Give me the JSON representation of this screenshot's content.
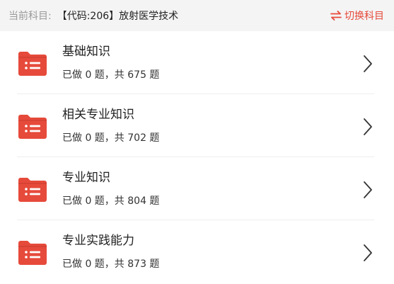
{
  "header": {
    "label": "当前科目:",
    "subject": "【代码:206】放射医学技术",
    "switch_label": "切换科目",
    "switch_icon": "swap-arrows-icon"
  },
  "colors": {
    "accent": "#e64a3b",
    "header_bg": "#f4f4f4"
  },
  "list": {
    "items": [
      {
        "title": "基础知识",
        "stats": "已做 0 题，共 675 题",
        "icon": "folder-list-icon"
      },
      {
        "title": "相关专业知识",
        "stats": "已做 0 题，共 702 题",
        "icon": "folder-list-icon"
      },
      {
        "title": "专业知识",
        "stats": "已做 0 题，共 804 题",
        "icon": "folder-list-icon"
      },
      {
        "title": "专业实践能力",
        "stats": "已做 0 题，共 873 题",
        "icon": "folder-list-icon"
      }
    ]
  }
}
